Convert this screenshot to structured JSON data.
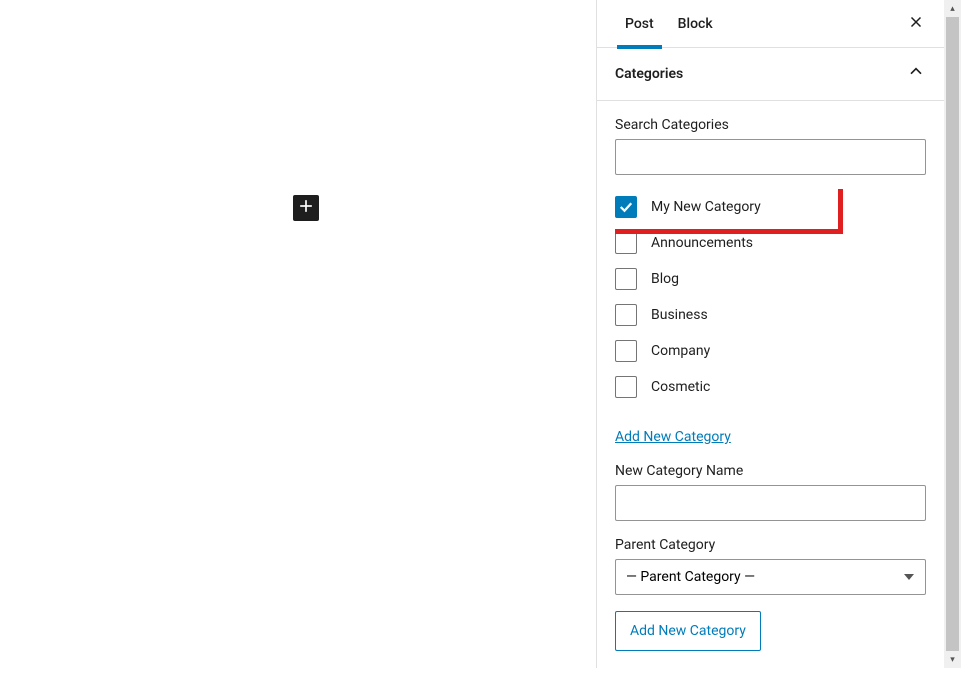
{
  "sidebar": {
    "tabs": {
      "post": "Post",
      "block": "Block"
    },
    "panel_title": "Categories",
    "search_label": "Search Categories",
    "categories": [
      {
        "label": "My New Category",
        "checked": true
      },
      {
        "label": "Announcements",
        "checked": false
      },
      {
        "label": "Blog",
        "checked": false
      },
      {
        "label": "Business",
        "checked": false
      },
      {
        "label": "Company",
        "checked": false
      },
      {
        "label": "Cosmetic",
        "checked": false
      }
    ],
    "add_new_link": "Add New Category",
    "new_category_label": "New Category Name",
    "parent_category_label": "Parent Category",
    "parent_category_placeholder": "— Parent Category —",
    "add_new_button": "Add New Category"
  },
  "icons": {
    "plus": "plus-icon",
    "close": "close-icon",
    "chevron_up": "chevron-up-icon",
    "check": "check-icon"
  }
}
